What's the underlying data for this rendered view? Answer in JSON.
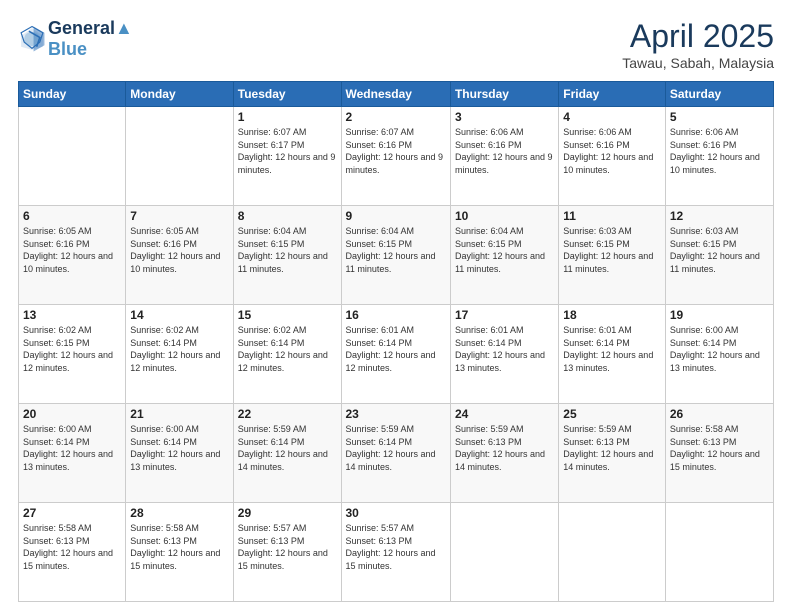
{
  "header": {
    "logo_line1": "General",
    "logo_line2": "Blue",
    "month_title": "April 2025",
    "location": "Tawau, Sabah, Malaysia"
  },
  "days_of_week": [
    "Sunday",
    "Monday",
    "Tuesday",
    "Wednesday",
    "Thursday",
    "Friday",
    "Saturday"
  ],
  "weeks": [
    [
      {
        "day": "",
        "info": ""
      },
      {
        "day": "",
        "info": ""
      },
      {
        "day": "1",
        "info": "Sunrise: 6:07 AM\nSunset: 6:17 PM\nDaylight: 12 hours and 9 minutes."
      },
      {
        "day": "2",
        "info": "Sunrise: 6:07 AM\nSunset: 6:16 PM\nDaylight: 12 hours and 9 minutes."
      },
      {
        "day": "3",
        "info": "Sunrise: 6:06 AM\nSunset: 6:16 PM\nDaylight: 12 hours and 9 minutes."
      },
      {
        "day": "4",
        "info": "Sunrise: 6:06 AM\nSunset: 6:16 PM\nDaylight: 12 hours and 10 minutes."
      },
      {
        "day": "5",
        "info": "Sunrise: 6:06 AM\nSunset: 6:16 PM\nDaylight: 12 hours and 10 minutes."
      }
    ],
    [
      {
        "day": "6",
        "info": "Sunrise: 6:05 AM\nSunset: 6:16 PM\nDaylight: 12 hours and 10 minutes."
      },
      {
        "day": "7",
        "info": "Sunrise: 6:05 AM\nSunset: 6:16 PM\nDaylight: 12 hours and 10 minutes."
      },
      {
        "day": "8",
        "info": "Sunrise: 6:04 AM\nSunset: 6:15 PM\nDaylight: 12 hours and 11 minutes."
      },
      {
        "day": "9",
        "info": "Sunrise: 6:04 AM\nSunset: 6:15 PM\nDaylight: 12 hours and 11 minutes."
      },
      {
        "day": "10",
        "info": "Sunrise: 6:04 AM\nSunset: 6:15 PM\nDaylight: 12 hours and 11 minutes."
      },
      {
        "day": "11",
        "info": "Sunrise: 6:03 AM\nSunset: 6:15 PM\nDaylight: 12 hours and 11 minutes."
      },
      {
        "day": "12",
        "info": "Sunrise: 6:03 AM\nSunset: 6:15 PM\nDaylight: 12 hours and 11 minutes."
      }
    ],
    [
      {
        "day": "13",
        "info": "Sunrise: 6:02 AM\nSunset: 6:15 PM\nDaylight: 12 hours and 12 minutes."
      },
      {
        "day": "14",
        "info": "Sunrise: 6:02 AM\nSunset: 6:14 PM\nDaylight: 12 hours and 12 minutes."
      },
      {
        "day": "15",
        "info": "Sunrise: 6:02 AM\nSunset: 6:14 PM\nDaylight: 12 hours and 12 minutes."
      },
      {
        "day": "16",
        "info": "Sunrise: 6:01 AM\nSunset: 6:14 PM\nDaylight: 12 hours and 12 minutes."
      },
      {
        "day": "17",
        "info": "Sunrise: 6:01 AM\nSunset: 6:14 PM\nDaylight: 12 hours and 13 minutes."
      },
      {
        "day": "18",
        "info": "Sunrise: 6:01 AM\nSunset: 6:14 PM\nDaylight: 12 hours and 13 minutes."
      },
      {
        "day": "19",
        "info": "Sunrise: 6:00 AM\nSunset: 6:14 PM\nDaylight: 12 hours and 13 minutes."
      }
    ],
    [
      {
        "day": "20",
        "info": "Sunrise: 6:00 AM\nSunset: 6:14 PM\nDaylight: 12 hours and 13 minutes."
      },
      {
        "day": "21",
        "info": "Sunrise: 6:00 AM\nSunset: 6:14 PM\nDaylight: 12 hours and 13 minutes."
      },
      {
        "day": "22",
        "info": "Sunrise: 5:59 AM\nSunset: 6:14 PM\nDaylight: 12 hours and 14 minutes."
      },
      {
        "day": "23",
        "info": "Sunrise: 5:59 AM\nSunset: 6:14 PM\nDaylight: 12 hours and 14 minutes."
      },
      {
        "day": "24",
        "info": "Sunrise: 5:59 AM\nSunset: 6:13 PM\nDaylight: 12 hours and 14 minutes."
      },
      {
        "day": "25",
        "info": "Sunrise: 5:59 AM\nSunset: 6:13 PM\nDaylight: 12 hours and 14 minutes."
      },
      {
        "day": "26",
        "info": "Sunrise: 5:58 AM\nSunset: 6:13 PM\nDaylight: 12 hours and 15 minutes."
      }
    ],
    [
      {
        "day": "27",
        "info": "Sunrise: 5:58 AM\nSunset: 6:13 PM\nDaylight: 12 hours and 15 minutes."
      },
      {
        "day": "28",
        "info": "Sunrise: 5:58 AM\nSunset: 6:13 PM\nDaylight: 12 hours and 15 minutes."
      },
      {
        "day": "29",
        "info": "Sunrise: 5:57 AM\nSunset: 6:13 PM\nDaylight: 12 hours and 15 minutes."
      },
      {
        "day": "30",
        "info": "Sunrise: 5:57 AM\nSunset: 6:13 PM\nDaylight: 12 hours and 15 minutes."
      },
      {
        "day": "",
        "info": ""
      },
      {
        "day": "",
        "info": ""
      },
      {
        "day": "",
        "info": ""
      }
    ]
  ]
}
